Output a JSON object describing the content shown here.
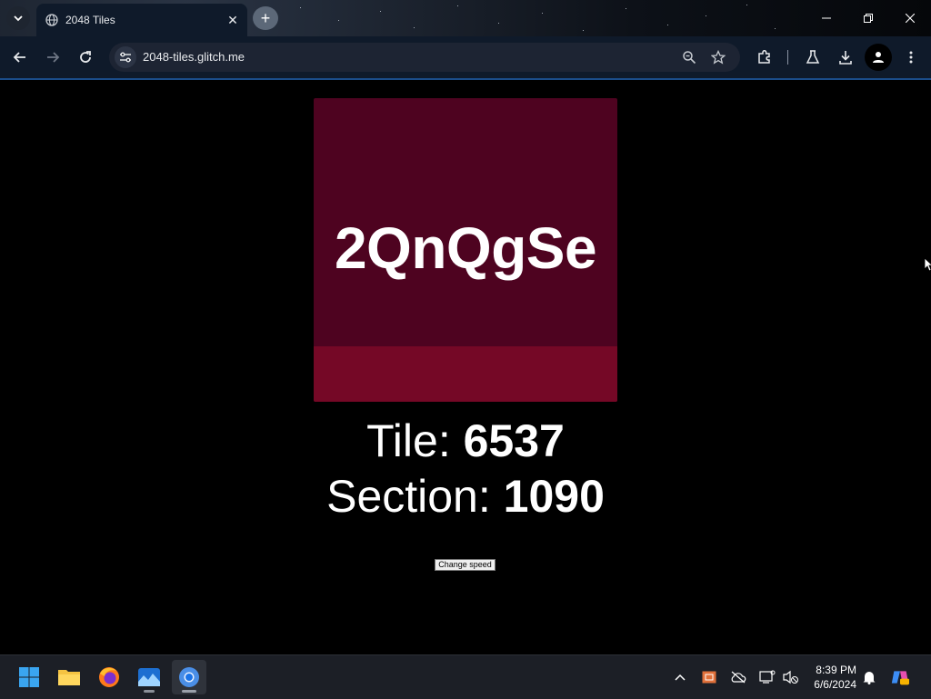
{
  "browser": {
    "tab_title": "2048 Tiles",
    "tab_close": "✕",
    "new_tab": "+",
    "url": "2048-tiles.glitch.me"
  },
  "page": {
    "tile_word": "2QnQgSe",
    "tile_label": "Tile: ",
    "tile_value": "6537",
    "section_label": "Section: ",
    "section_value": "1090",
    "change_speed_label": "Change speed",
    "colors": {
      "card": "#4e0320",
      "card_bar": "#750826",
      "background": "#000000"
    }
  },
  "taskbar": {
    "apps": [
      "start-icon",
      "file-explorer-icon",
      "firefox-icon",
      "photos-icon",
      "chrome-icon"
    ],
    "time": "8:39 PM",
    "date": "6/6/2024"
  }
}
